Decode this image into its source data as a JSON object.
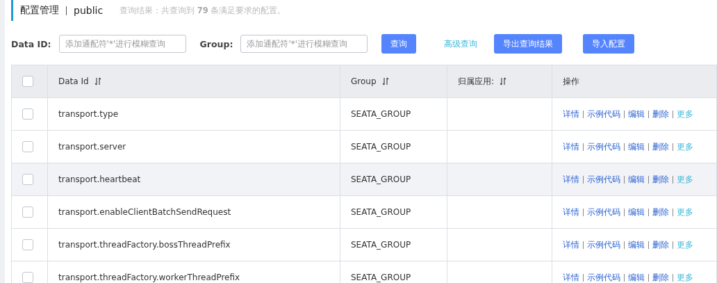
{
  "header": {
    "title": "配置管理",
    "namespace": "public",
    "summary": "查询结果：共查询到 **79** 条满足要求的配置。"
  },
  "filters": [
    {
      "label": "Data ID:",
      "placeholder": "添加通配符'*'进行模糊查询"
    },
    {
      "label": "Group:",
      "placeholder": "添加通配符'*'进行模糊查询"
    }
  ],
  "actions": [
    {
      "kind": "button",
      "label": "查询"
    },
    {
      "kind": "link",
      "label": "高级查询"
    },
    {
      "kind": "button",
      "label": "导出查询结果"
    },
    {
      "kind": "button",
      "label": "导入配置"
    }
  ],
  "table": {
    "all_checked": false,
    "columns": [
      {
        "label": "Data Id",
        "sortable": true
      },
      {
        "label": "Group",
        "sortable": true
      },
      {
        "label": "归属应用:",
        "sortable": true
      },
      {
        "label": "操作",
        "sortable": false
      }
    ],
    "rows": [
      {
        "checked": false,
        "highlighted": false,
        "data_id": "transport.type",
        "group": "SEATA_GROUP",
        "ops": [
          "详情",
          "示例代码",
          "编辑",
          "删除",
          "更多"
        ]
      },
      {
        "checked": false,
        "highlighted": false,
        "data_id": "transport.server",
        "group": "SEATA_GROUP",
        "ops": [
          "详情",
          "示例代码",
          "编辑",
          "删除",
          "更多"
        ]
      },
      {
        "checked": false,
        "highlighted": true,
        "data_id": "transport.heartbeat",
        "group": "SEATA_GROUP",
        "ops": [
          "详情",
          "示例代码",
          "编辑",
          "删除",
          "更多"
        ]
      },
      {
        "checked": false,
        "highlighted": false,
        "data_id": "transport.enableClientBatchSendRequest",
        "group": "SEATA_GROUP",
        "ops": [
          "详情",
          "示例代码",
          "编辑",
          "删除",
          "更多"
        ]
      },
      {
        "checked": false,
        "highlighted": false,
        "data_id": "transport.threadFactory.bossThreadPrefix",
        "group": "SEATA_GROUP",
        "ops": [
          "详情",
          "示例代码",
          "编辑",
          "删除",
          "更多"
        ]
      },
      {
        "checked": false,
        "highlighted": false,
        "data_id": "transport.threadFactory.workerThreadPrefix",
        "group": "SEATA_GROUP",
        "ops": [
          "详情",
          "示例代码",
          "编辑",
          "删除",
          "更多"
        ]
      }
    ]
  }
}
